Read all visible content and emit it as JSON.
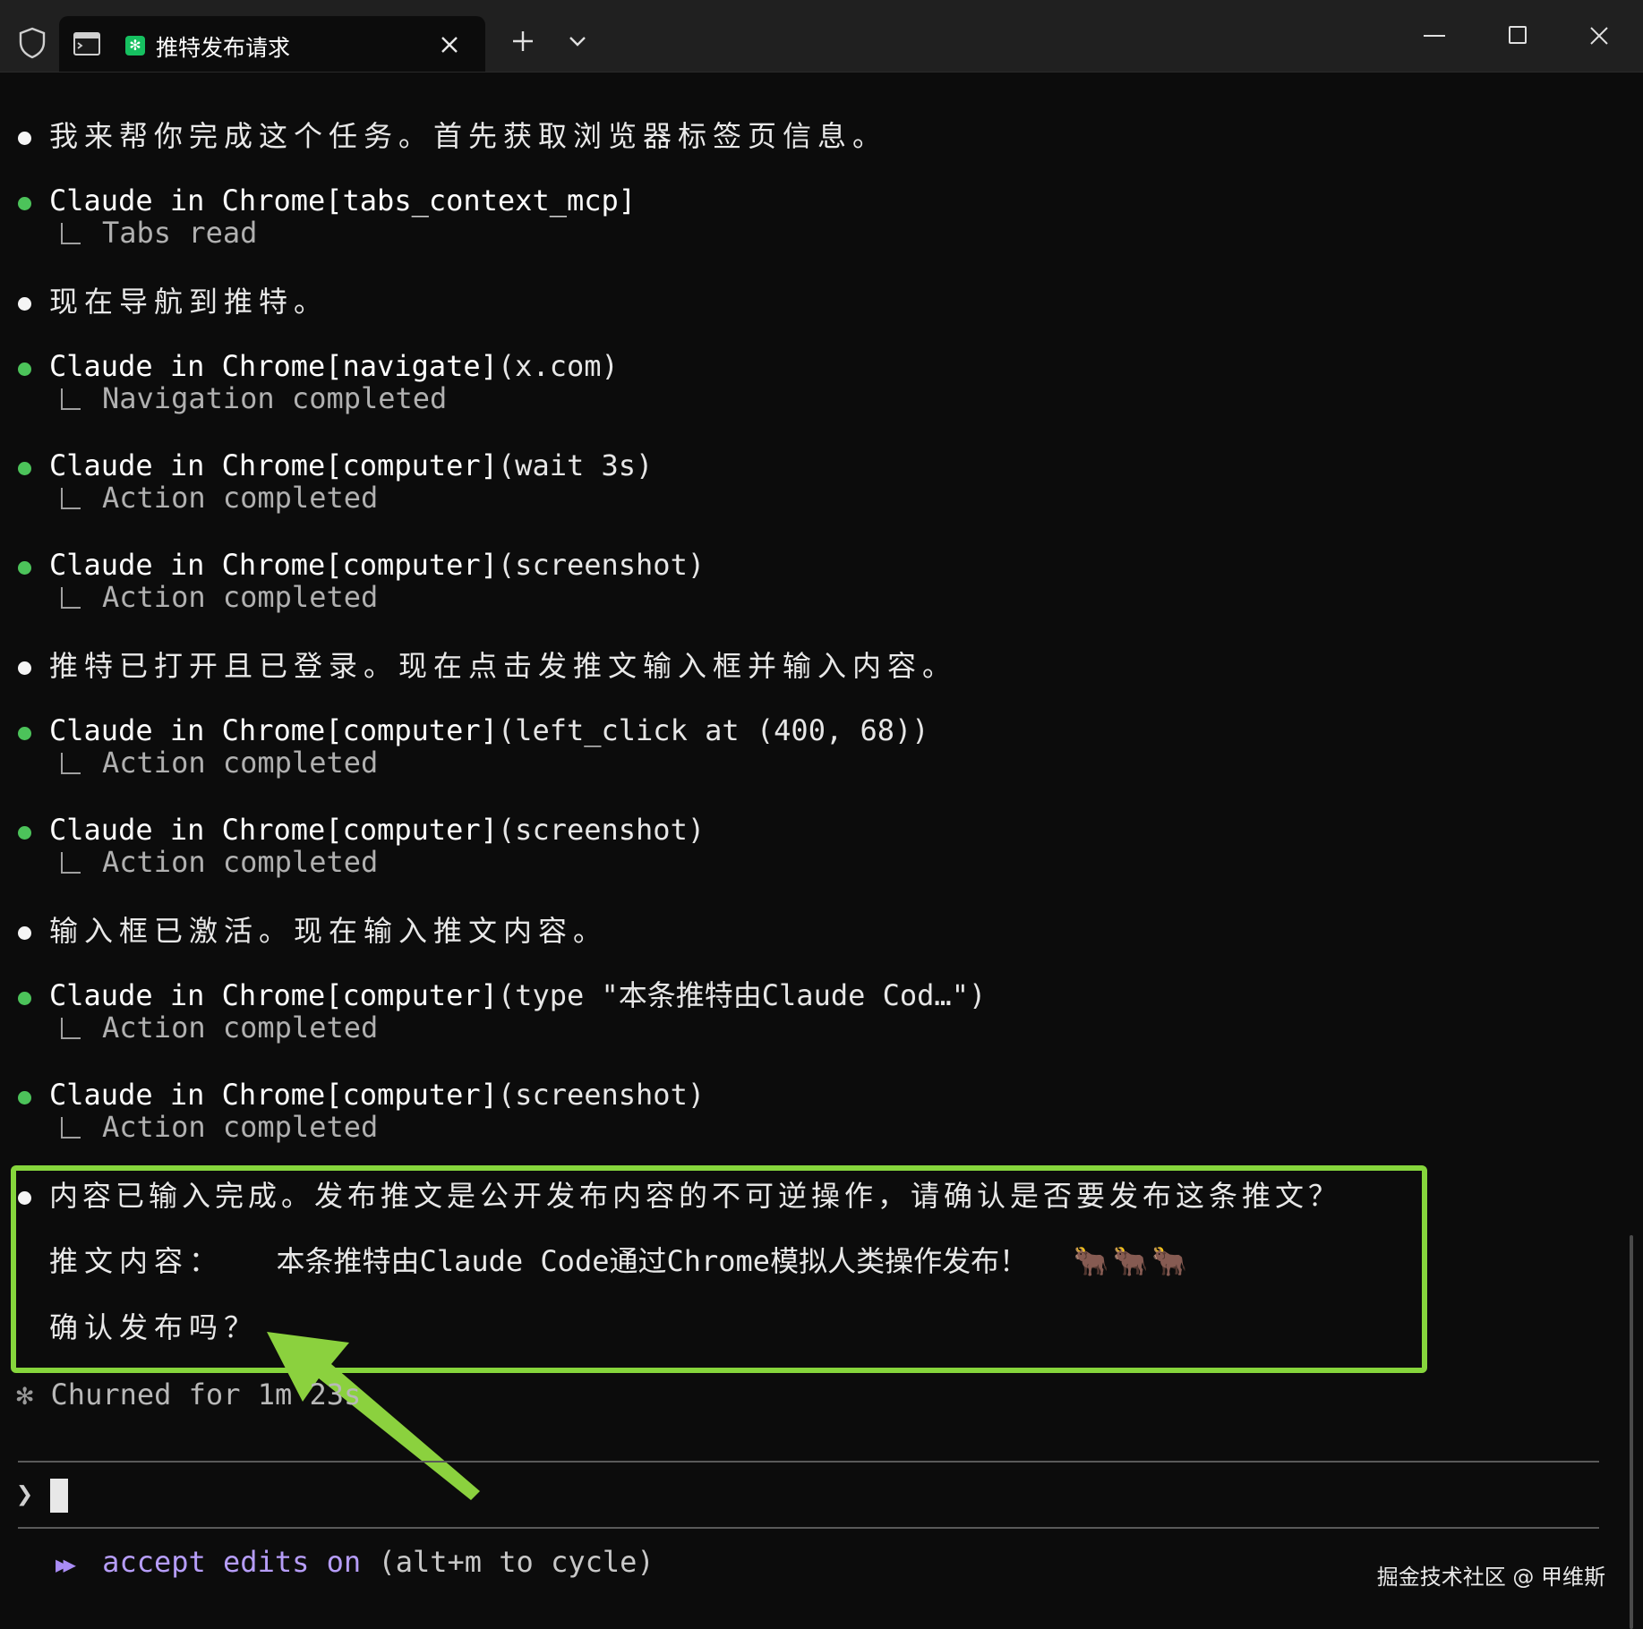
{
  "window": {
    "tab_title": "推特发布请求",
    "app_icon_glyph": "✻",
    "accent_color": "#16c060"
  },
  "messages": [
    {
      "kind": "text",
      "text": "我来帮你完成这个任务。首先获取浏览器标签页信息。"
    },
    {
      "kind": "tool",
      "name": "Claude in Chrome[tabs_context_mcp]",
      "args": "",
      "result": "Tabs read"
    },
    {
      "kind": "text",
      "text": "现在导航到推特。"
    },
    {
      "kind": "tool",
      "name": "Claude in Chrome[navigate]",
      "args": "(x.com)",
      "result": "Navigation completed"
    },
    {
      "kind": "tool",
      "name": "Claude in Chrome[computer]",
      "args": "(wait 3s)",
      "result": "Action completed"
    },
    {
      "kind": "tool",
      "name": "Claude in Chrome[computer]",
      "args": "(screenshot)",
      "result": "Action completed"
    },
    {
      "kind": "text",
      "text": "推特已打开且已登录。现在点击发推文输入框并输入内容。"
    },
    {
      "kind": "tool",
      "name": "Claude in Chrome[computer]",
      "args": "(left_click at (400, 68))",
      "result": "Action completed"
    },
    {
      "kind": "tool",
      "name": "Claude in Chrome[computer]",
      "args": "(screenshot)",
      "result": "Action completed"
    },
    {
      "kind": "text",
      "text": "输入框已激活。现在输入推文内容。"
    },
    {
      "kind": "tool",
      "name": "Claude in Chrome[computer]",
      "args": "(type \"本条推特由Claude Cod…\")",
      "result": "Action completed"
    },
    {
      "kind": "tool",
      "name": "Claude in Chrome[computer]",
      "args": "(screenshot)",
      "result": "Action completed"
    }
  ],
  "confirm": {
    "line1": "内容已输入完成。发布推文是公开发布内容的不可逆操作，请确认是否要发布这条推文？",
    "line2_label": "推文内容：",
    "line2_text": "本条推特由Claude Code通过Chrome模拟人类操作发布！",
    "line2_emoji": "🐂🐂🐂",
    "line3": "确认发布吗？",
    "highlight_color": "#86d63c"
  },
  "status": {
    "star": "✻",
    "text": "Churned for 1m 23s"
  },
  "prompt": {
    "symbol": "❯"
  },
  "mode": {
    "icon": "▶▶",
    "text": "accept edits on",
    "hint": "(alt+m to cycle)",
    "color": "#b69df8"
  },
  "watermark": "掘金技术社区 @ 甲维斯"
}
